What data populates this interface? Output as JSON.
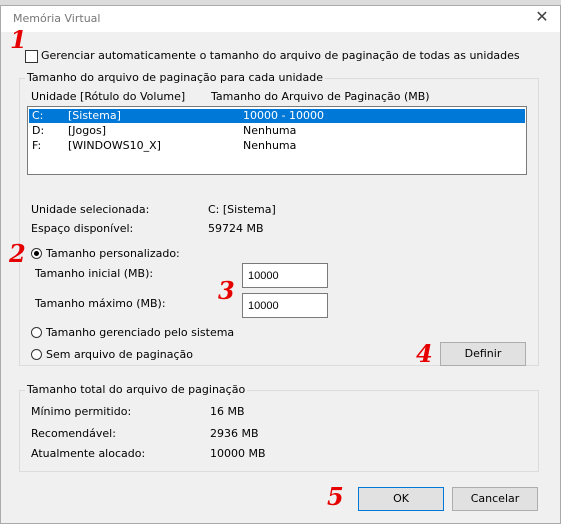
{
  "window": {
    "title": "Memória Virtual",
    "close_icon": "close-icon"
  },
  "auto_manage_label": "Gerenciar automaticamente o tamanho do arquivo de paginação de todas as unidades",
  "per_drive": {
    "group_label": "Tamanho do arquivo de paginação para cada unidade",
    "col_drive": "Unidade [Rótulo do Volume]",
    "col_size": "Tamanho do Arquivo de Paginação (MB)",
    "rows": [
      {
        "drive": "C:",
        "label": "[Sistema]",
        "size": "10000 - 10000",
        "selected": true
      },
      {
        "drive": "D:",
        "label": "[Jogos]",
        "size": "Nenhuma",
        "selected": false
      },
      {
        "drive": "F:",
        "label": "[WINDOWS10_X]",
        "size": "Nenhuma",
        "selected": false
      }
    ],
    "selected_drive_label": "Unidade selecionada:",
    "selected_drive_value": "C:  [Sistema]",
    "free_space_label": "Espaço disponível:",
    "free_space_value": "59724 MB"
  },
  "options": {
    "custom_size_label": "Tamanho personalizado:",
    "initial_size_label": "Tamanho inicial (MB):",
    "initial_size_value": "10000",
    "max_size_label": "Tamanho máximo (MB):",
    "max_size_value": "10000",
    "system_managed_label": "Tamanho gerenciado pelo sistema",
    "no_paging_label": "Sem arquivo de paginação",
    "set_button": "Definir"
  },
  "totals": {
    "group_label": "Tamanho total do arquivo de paginação",
    "min_label": "Mínimo permitido:",
    "min_value": "16 MB",
    "recommended_label": "Recomendável:",
    "recommended_value": "2936 MB",
    "allocated_label": "Atualmente alocado:",
    "allocated_value": "10000 MB"
  },
  "buttons": {
    "ok": "OK",
    "cancel": "Cancelar"
  },
  "annotations": [
    "1",
    "2",
    "3",
    "4",
    "5"
  ],
  "accent_color": "#0078d7",
  "annotation_color": "#e60000"
}
